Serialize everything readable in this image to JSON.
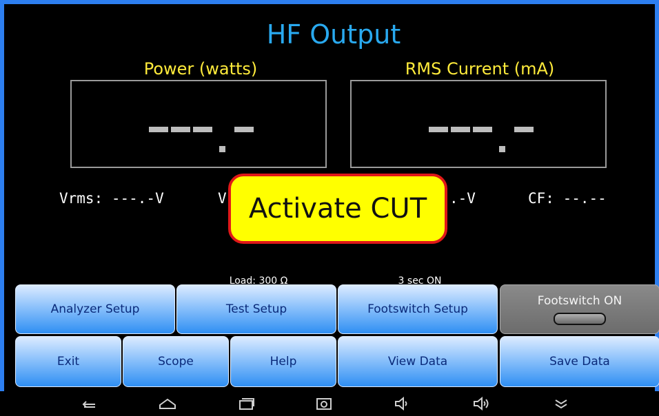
{
  "title": "HF Output",
  "meters": {
    "power": {
      "label": "Power (watts)"
    },
    "current": {
      "label": "RMS Current (mA)"
    }
  },
  "readouts": {
    "vrms": "Vrms: ---.-V",
    "vpeak": "V",
    "vpp": ".-V",
    "cf": "CF: --.--"
  },
  "toast": {
    "text": "Activate CUT"
  },
  "captions": {
    "load": "Load: 300 Ω",
    "footswitch_time": "3 sec ON"
  },
  "buttons": {
    "analyzer_setup": "Analyzer Setup",
    "test_setup": "Test Setup",
    "footswitch_setup": "Footswitch Setup",
    "footswitch_on": "Footswitch ON",
    "exit": "Exit",
    "scope": "Scope",
    "help": "Help",
    "view_data": "View Data",
    "save_data": "Save Data"
  },
  "navbar": {
    "icons": [
      "back-icon",
      "home-icon",
      "recents-icon",
      "screenshot-icon",
      "volume-down-icon",
      "volume-up-icon",
      "collapse-icon"
    ]
  },
  "colors": {
    "frame": "#2d7ff0",
    "title": "#29a9ef",
    "meter_label": "#ffeb3b",
    "toast_bg": "#ffff00",
    "toast_border": "#e01818",
    "button_text": "#0a2a7a"
  }
}
